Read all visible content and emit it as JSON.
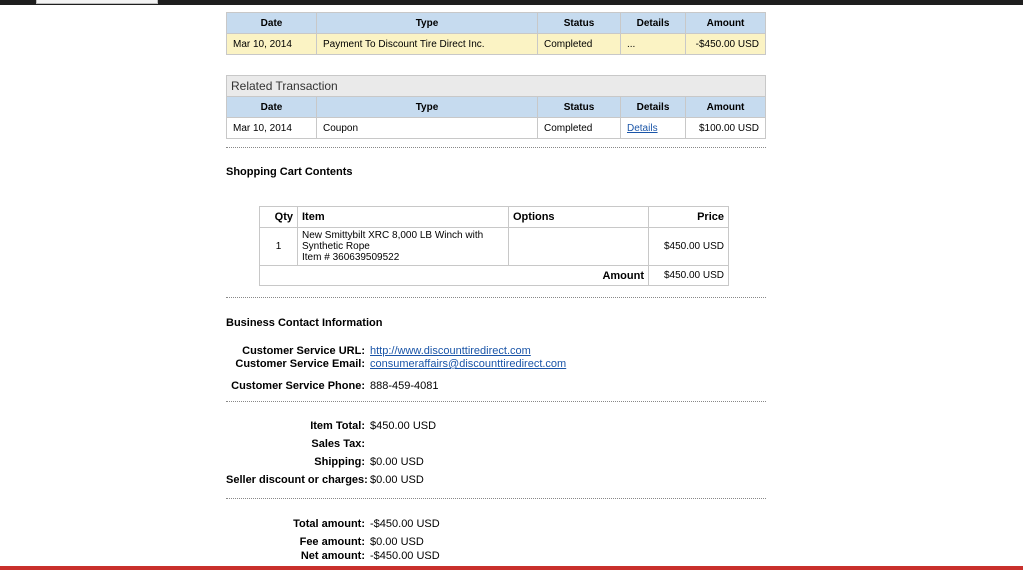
{
  "main_tx": {
    "headers": [
      "Date",
      "Type",
      "Status",
      "Details",
      "Amount"
    ],
    "row": {
      "date": "Mar 10, 2014",
      "type": "Payment To Discount Tire Direct Inc.",
      "status": "Completed",
      "details": "...",
      "amount": "-$450.00 USD"
    }
  },
  "related_tx": {
    "title": "Related Transaction",
    "headers": [
      "Date",
      "Type",
      "Status",
      "Details",
      "Amount"
    ],
    "row": {
      "date": "Mar 10, 2014",
      "type": "Coupon",
      "status": "Completed",
      "details": "Details",
      "amount": "$100.00 USD"
    }
  },
  "cart": {
    "title": "Shopping Cart Contents",
    "headers": {
      "qty": "Qty",
      "item": "Item",
      "options": "Options",
      "price": "Price"
    },
    "item": {
      "qty": "1",
      "line1": "New Smittybilt XRC 8,000 LB Winch with",
      "line2": "Synthetic Rope",
      "line3": "Item # 360639509522",
      "options": "",
      "price": "$450.00 USD"
    },
    "amount_label": "Amount",
    "amount_value": "$450.00 USD"
  },
  "contact": {
    "title": "Business Contact Information",
    "url_label": "Customer Service URL:",
    "url_value": "http://www.discounttiredirect.com",
    "email_label": "Customer Service Email:",
    "email_value": "consumeraffairs@discounttiredirect.com",
    "phone_label": "Customer Service Phone:",
    "phone_value": "888-459-4081"
  },
  "totals": {
    "item_total_label": "Item Total:",
    "item_total_value": "$450.00 USD",
    "sales_tax_label": "Sales Tax:",
    "sales_tax_value": "",
    "shipping_label": "Shipping:",
    "shipping_value": "$0.00 USD",
    "discount_label": "Seller discount or charges:",
    "discount_value": "$0.00 USD"
  },
  "summary": {
    "total_label": "Total amount:",
    "total_value": "-$450.00 USD",
    "fee_label": "Fee amount:",
    "fee_value": "$0.00 USD",
    "net_label": "Net amount:",
    "net_value": "-$450.00 USD"
  }
}
